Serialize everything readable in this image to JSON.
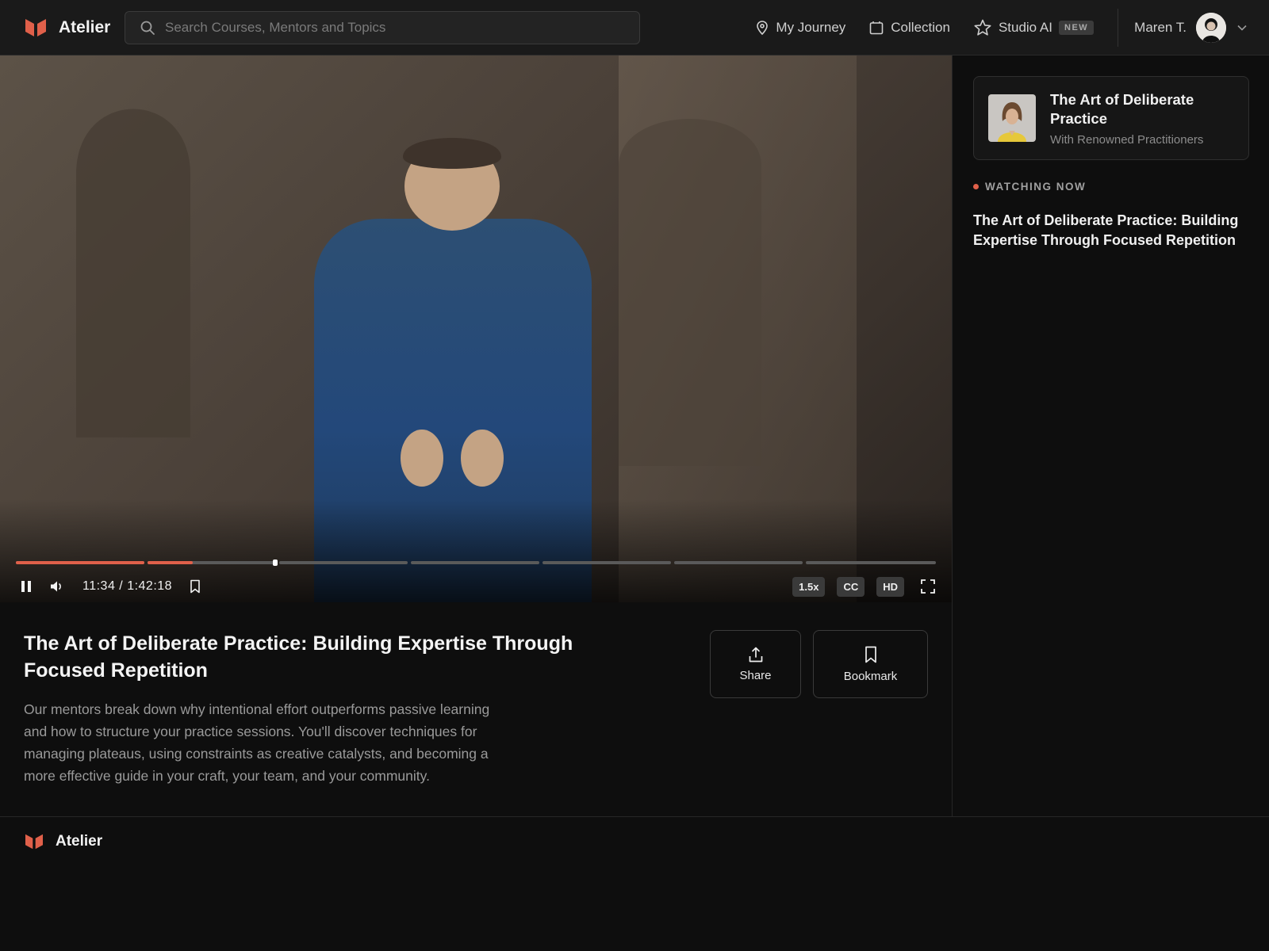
{
  "app": {
    "name": "Atelier",
    "accent_color": "#e0604a"
  },
  "search": {
    "placeholder": "Search Courses, Mentors and Topics"
  },
  "nav": {
    "journey": "My Journey",
    "collection": "Collection",
    "studio_ai": "Studio AI",
    "studio_ai_badge": "NEW"
  },
  "user": {
    "name": "Maren T."
  },
  "player": {
    "timecode": "11:34 / 1:42:18",
    "speed": "1.5x",
    "captions": "CC",
    "quality": "HD",
    "progress_fraction": 0.113
  },
  "video": {
    "title": "The Art of Deliberate Practice: Building Expertise Through Focused Repetition",
    "description": "Our mentors break down why intentional effort outperforms passive learning and how to structure your practice sessions. You'll discover techniques for managing plateaus, using constraints as creative catalysts, and becoming a more effective guide in your craft, your team, and your community.",
    "share_label": "Share",
    "bookmark_label": "Bookmark"
  },
  "sidebar": {
    "course_title": "The Art of Deliberate Practice",
    "course_subtitle": "With Renowned Practitioners",
    "watching_label": "WATCHING NOW",
    "watching_title": "The Art of Deliberate Practice: Building Expertise Through Focused Repetition"
  },
  "footer": {
    "brand": "Atelier"
  }
}
